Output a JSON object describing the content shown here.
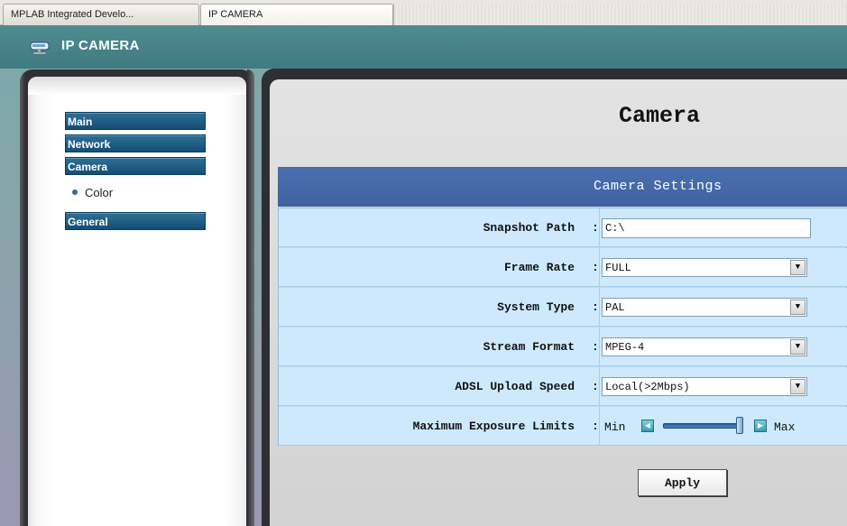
{
  "browser": {
    "tabs": [
      {
        "label": "MPLAB Integrated Develo..."
      },
      {
        "label": "IP CAMERA"
      }
    ]
  },
  "header": {
    "title": "IP CAMERA",
    "icon": "network-camera-icon"
  },
  "sidebar": {
    "items": [
      {
        "label": "Main"
      },
      {
        "label": "Network"
      },
      {
        "label": "Camera"
      },
      {
        "label": "General"
      }
    ],
    "subitems": [
      {
        "label": "Color"
      }
    ]
  },
  "main": {
    "heading": "Camera",
    "section_title": "Camera Settings",
    "rows": [
      {
        "label": "Snapshot Path",
        "colon": ":",
        "value": "C:\\"
      },
      {
        "label": "Frame Rate",
        "colon": ":",
        "value": "FULL"
      },
      {
        "label": "System Type",
        "colon": ":",
        "value": "PAL"
      },
      {
        "label": "Stream Format",
        "colon": ":",
        "value": "MPEG-4"
      },
      {
        "label": "ADSL Upload Speed",
        "colon": ":",
        "value": "Local(>2Mbps)"
      },
      {
        "label": "Maximum Exposure Limits",
        "colon": ":",
        "min_label": "Min",
        "max_label": "Max",
        "slider_level": 1.0
      }
    ],
    "apply_label": "Apply"
  },
  "colors": {
    "header_bg": "#4a878b",
    "nav_button": "#1b5a84",
    "section_header": "#4468aa",
    "row_bg": "#cde9fb"
  }
}
